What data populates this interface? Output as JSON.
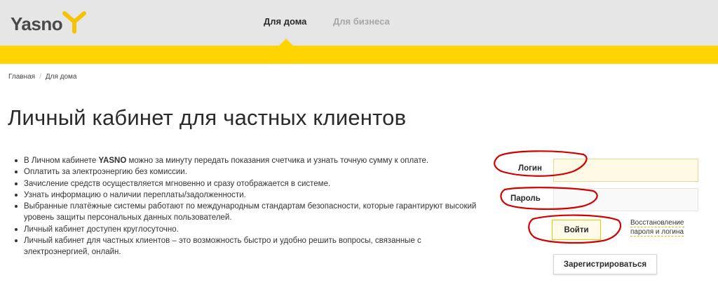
{
  "header": {
    "logo_text": "Yasno",
    "nav": [
      {
        "label": "Для дома",
        "active": true
      },
      {
        "label": "Для бизнеса",
        "active": false
      }
    ],
    "accent_color": "#ffd400"
  },
  "breadcrumb": {
    "items": [
      "Главная",
      "Для дома"
    ],
    "separator": "/"
  },
  "page_title": "Личный кабинет для частных клиентов",
  "features": {
    "items": [
      {
        "before": "В Личном кабинете ",
        "bold": "YASNO",
        "after": " можно за минуту передать показания счетчика и узнать точную сумму к оплате."
      },
      {
        "before": "Оплатить за электроэнергию без комиссии.",
        "bold": "",
        "after": ""
      },
      {
        "before": "Зачисление средств осуществляется мгновенно и сразу отображается в системе.",
        "bold": "",
        "after": ""
      },
      {
        "before": "Узнать информацию о наличии переплаты/задолженности.",
        "bold": "",
        "after": ""
      },
      {
        "before": "Выбранные платёжные системы работают по международным стандартам безопасности, которые гарантируют высокий уровень защиты персональных данных пользователей.",
        "bold": "",
        "after": ""
      },
      {
        "before": "Личный кабинет доступен круглосуточно.",
        "bold": "",
        "after": ""
      },
      {
        "before": "Личный кабинет для частных клиентов – это возможность быстро и удобно решить вопросы, связанные с электроэнергией, онлайн.",
        "bold": "",
        "after": ""
      }
    ]
  },
  "form": {
    "login_label": "Логин",
    "login_value": "",
    "password_label": "Пароль",
    "password_value": "",
    "submit_label": "Войти",
    "restore_link": "Восстановление пароля и логина",
    "register_label": "Зарегистрироваться"
  },
  "annotation_color": "#d40000"
}
